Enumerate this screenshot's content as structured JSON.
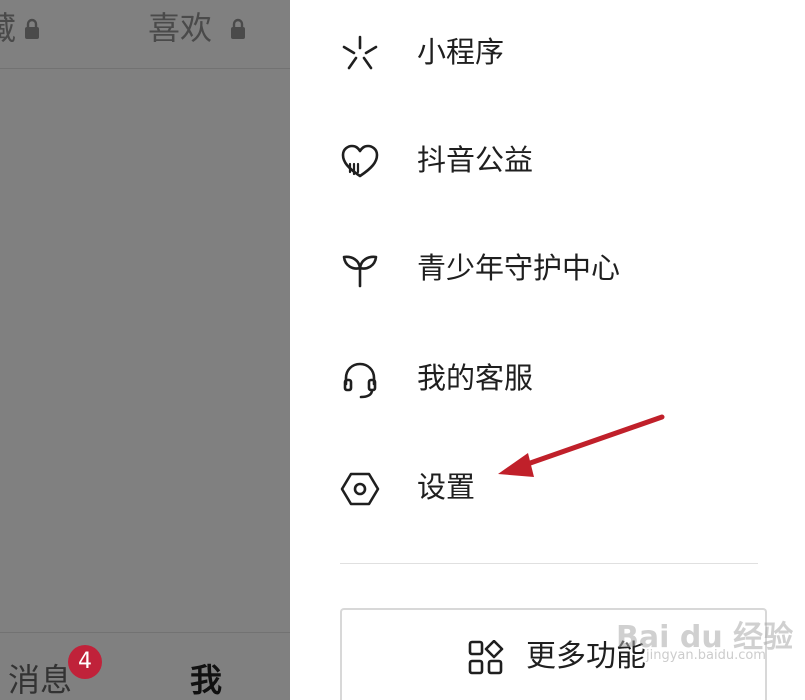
{
  "top_tabs": {
    "collection_partial": "藏",
    "likes": "喜欢"
  },
  "bottom_nav": {
    "messages_label": "消息",
    "messages_badge": "4",
    "me_label": "我"
  },
  "drawer": {
    "items": [
      {
        "label": "小程序",
        "icon": "mini-program-icon"
      },
      {
        "label": "抖音公益",
        "icon": "charity-heart-icon"
      },
      {
        "label": "青少年守护中心",
        "icon": "sprout-icon"
      },
      {
        "label": "我的客服",
        "icon": "headset-icon"
      },
      {
        "label": "设置",
        "icon": "settings-hexagon-icon"
      }
    ],
    "more_button": {
      "label": "更多功能",
      "icon": "grid-apps-icon"
    }
  },
  "watermark": {
    "text": "Bai du 经验",
    "url": "jingyan.baidu.com"
  },
  "colors": {
    "overlay": "#808080",
    "badge": "#c0223a",
    "arrow": "#c0202a"
  }
}
